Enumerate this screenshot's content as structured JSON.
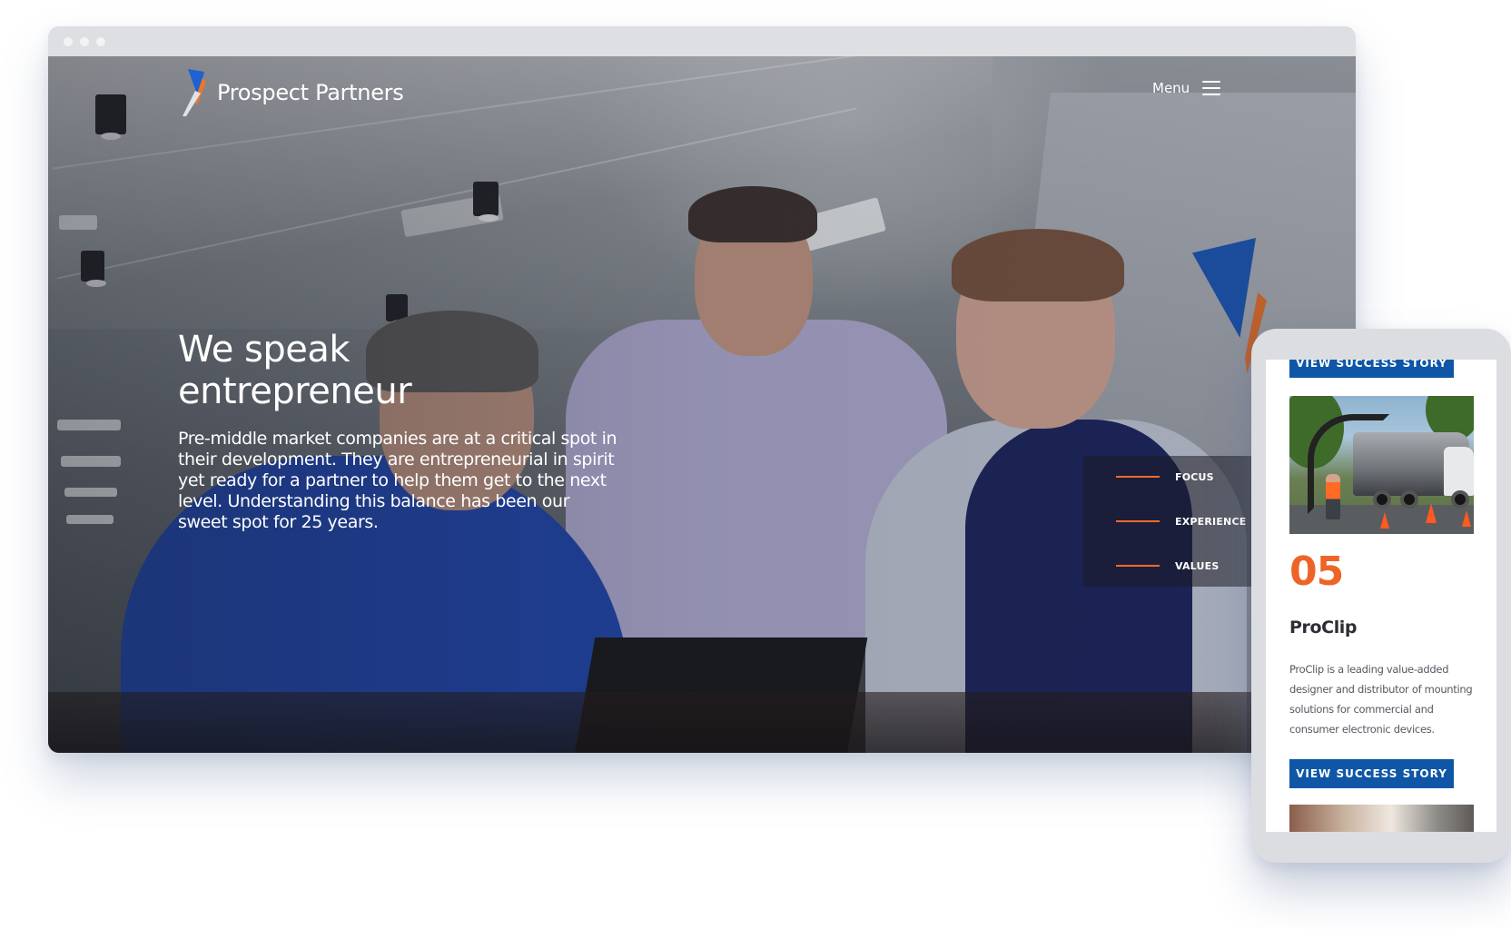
{
  "desktop": {
    "brand": {
      "name": "Prospect Partners"
    },
    "menu": {
      "label": "Menu"
    },
    "hero": {
      "title_line1": "We speak",
      "title_line2": "entrepreneur",
      "description": "Pre-middle market companies are at a critical spot in their development. They are entrepreneurial in spirit yet ready for a partner to help them get to the next level. Understanding this balance has been our sweet spot for 25 years."
    },
    "side_nav": {
      "items": [
        {
          "label": "FOCUS"
        },
        {
          "label": "EXPERIENCE"
        },
        {
          "label": "VALUES"
        }
      ]
    }
  },
  "mobile": {
    "top_button": "VIEW SUCCESS STORY",
    "story": {
      "number": "05",
      "name": "ProClip",
      "description": "ProClip is a leading value-added designer and distributor of mounting solutions for commercial and consumer electronic devices.",
      "button": "VIEW SUCCESS STORY"
    }
  },
  "colors": {
    "accent_orange": "#ee6427",
    "button_blue": "#0f57a6",
    "brand_blue": "#1e62d0"
  }
}
